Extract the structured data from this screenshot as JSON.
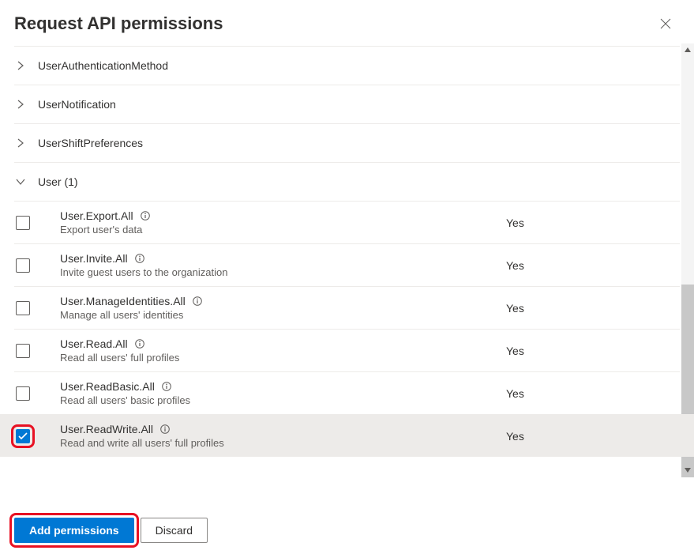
{
  "title": "Request API permissions",
  "categories": [
    {
      "label": "UserAuthenticationMethod",
      "expanded": false
    },
    {
      "label": "UserNotification",
      "expanded": false
    },
    {
      "label": "UserShiftPreferences",
      "expanded": false
    },
    {
      "label": "User (1)",
      "expanded": true
    }
  ],
  "permissions": [
    {
      "name": "User.Export.All",
      "desc": "Export user's data",
      "admin": "Yes",
      "checked": false
    },
    {
      "name": "User.Invite.All",
      "desc": "Invite guest users to the organization",
      "admin": "Yes",
      "checked": false
    },
    {
      "name": "User.ManageIdentities.All",
      "desc": "Manage all users' identities",
      "admin": "Yes",
      "checked": false
    },
    {
      "name": "User.Read.All",
      "desc": "Read all users' full profiles",
      "admin": "Yes",
      "checked": false
    },
    {
      "name": "User.ReadBasic.All",
      "desc": "Read all users' basic profiles",
      "admin": "Yes",
      "checked": false
    },
    {
      "name": "User.ReadWrite.All",
      "desc": "Read and write all users' full profiles",
      "admin": "Yes",
      "checked": true
    }
  ],
  "buttons": {
    "add": "Add permissions",
    "discard": "Discard"
  }
}
